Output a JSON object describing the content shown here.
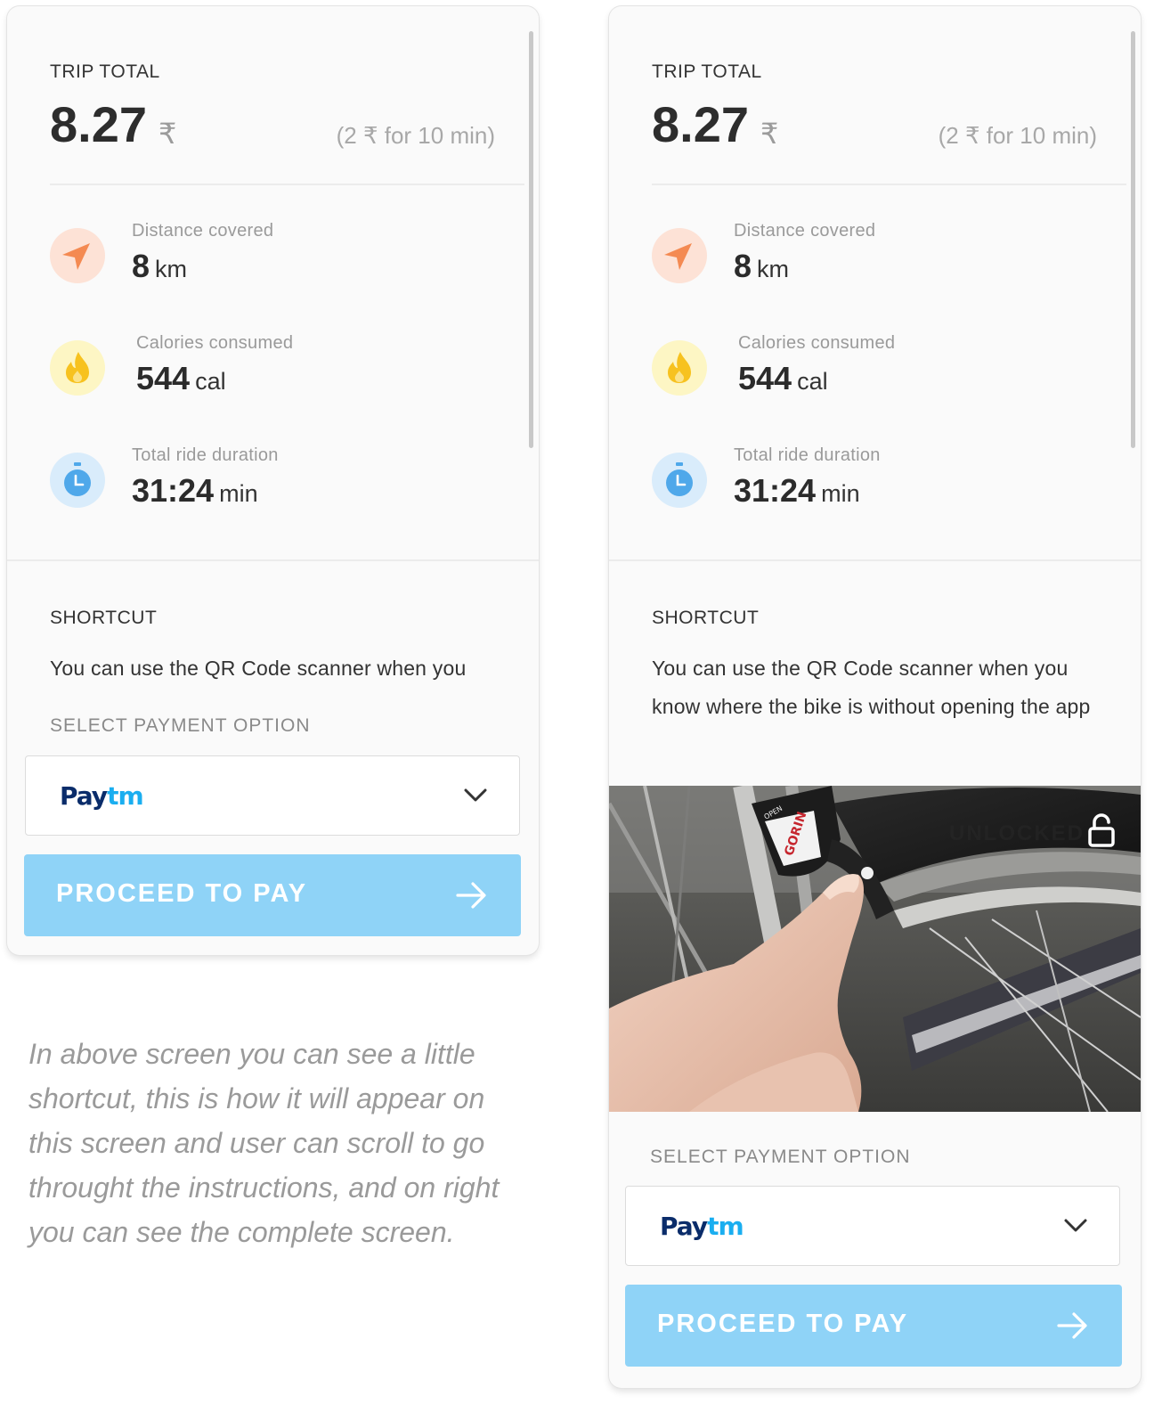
{
  "colors": {
    "accent_button": "#8fd3f7",
    "distance_icon_bg": "#fde2d6",
    "distance_icon": "#f48a52",
    "calories_icon_bg": "#fdf6c4",
    "calories_icon": "#f7c21f",
    "duration_icon_bg": "#d9ecfb",
    "duration_icon": "#4fa8ea",
    "paytm_dark": "#0a2c6a",
    "paytm_light": "#1aaef0"
  },
  "screens": {
    "left": {
      "trip_total_label": "TRIP TOTAL",
      "total_value": "8.27",
      "currency_symbol": "₹",
      "rate_text": "(2 ₹ for 10 min)",
      "stats": [
        {
          "label": "Distance covered",
          "value": "8",
          "unit": "km",
          "icon": "navigation-arrow-icon"
        },
        {
          "label": "Calories consumed",
          "value": "544",
          "unit": "cal",
          "icon": "flame-icon"
        },
        {
          "label": "Total ride duration",
          "value": "31:24",
          "unit": "min",
          "icon": "stopwatch-icon"
        }
      ],
      "shortcut_label": "SHORTCUT",
      "shortcut_text": "You can use the QR Code scanner when you",
      "payment_label": "SELECT PAYMENT OPTION",
      "payment_pay": "Pay",
      "payment_tm": "tm",
      "proceed_label": "PROCEED TO PAY"
    },
    "right": {
      "trip_total_label": "TRIP TOTAL",
      "total_value": "8.27",
      "currency_symbol": "₹",
      "rate_text": "(2 ₹ for 10 min)",
      "stats": [
        {
          "label": "Distance covered",
          "value": "8",
          "unit": "km",
          "icon": "navigation-arrow-icon"
        },
        {
          "label": "Calories consumed",
          "value": "544",
          "unit": "cal",
          "icon": "flame-icon"
        },
        {
          "label": "Total ride duration",
          "value": "31:24",
          "unit": "min",
          "icon": "stopwatch-icon"
        }
      ],
      "shortcut_label": "SHORTCUT",
      "shortcut_text": "You can use the QR Code scanner when you know where the bike is without opening the app",
      "photo_overlay_text": "UNLOCKED",
      "photo_lock_text": "OPEN",
      "photo_brand_text": "GORIN",
      "payment_label": "SELECT PAYMENT OPTION",
      "payment_pay": "Pay",
      "payment_tm": "tm",
      "proceed_label": "PROCEED TO PAY"
    }
  },
  "caption": "In above screen you can see a little shortcut, this is how it will appear on this screen and user can scroll to go throught the instructions, and on right you can see the complete screen."
}
